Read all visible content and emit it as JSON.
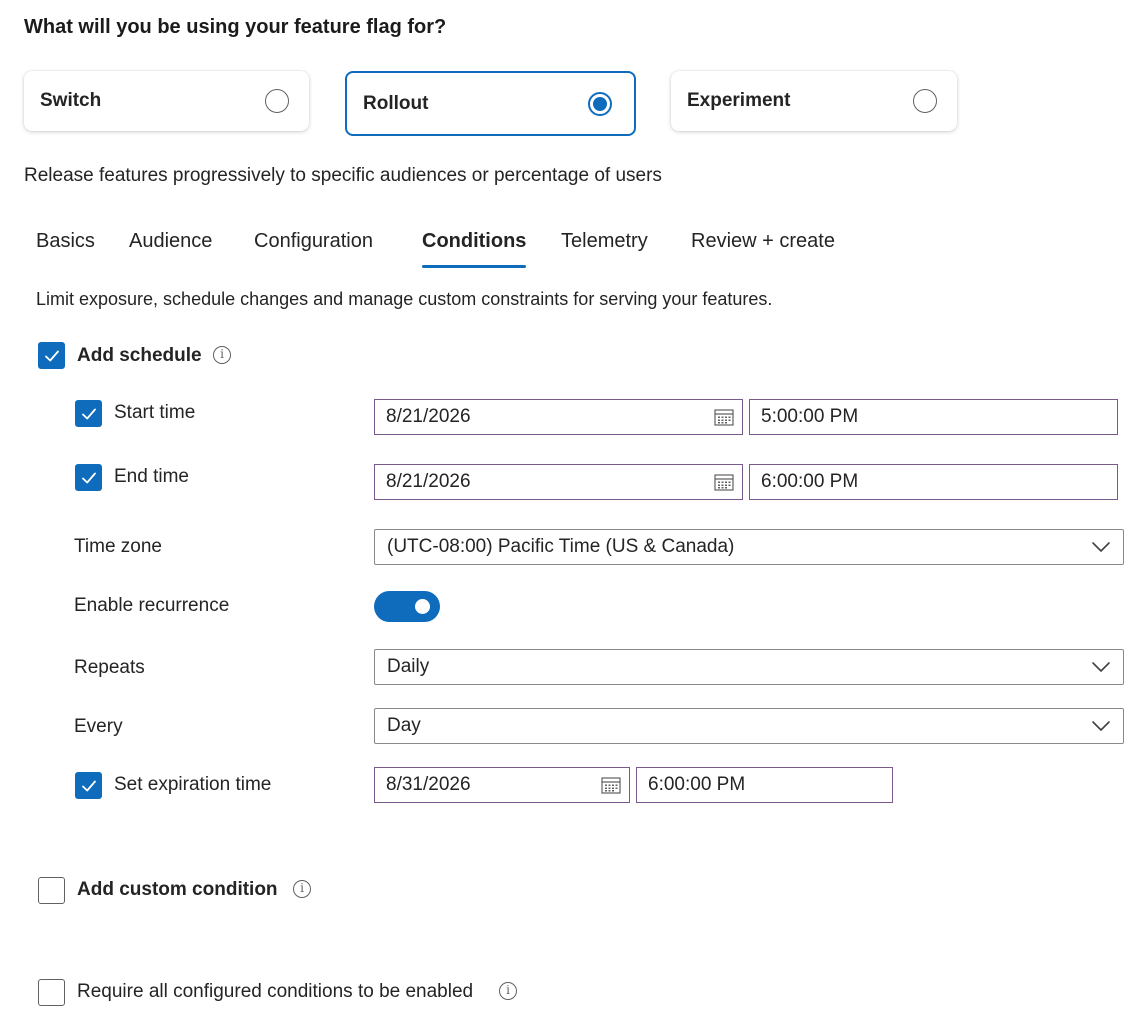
{
  "heading": "What will you be using your feature flag for?",
  "flag_types": [
    {
      "label": "Switch",
      "selected": false
    },
    {
      "label": "Rollout",
      "selected": true
    },
    {
      "label": "Experiment",
      "selected": false
    }
  ],
  "description": "Release features progressively to specific audiences or percentage of users",
  "tabs": [
    "Basics",
    "Audience",
    "Configuration",
    "Conditions",
    "Telemetry",
    "Review + create"
  ],
  "active_tab": "Conditions",
  "conditions_description": "Limit exposure, schedule changes and manage custom constraints for serving your features.",
  "schedule": {
    "label": "Add schedule",
    "checked": true,
    "start_time": {
      "label": "Start time",
      "date": "8/21/2026",
      "time": "5:00:00 PM"
    },
    "end_time": {
      "label": "End time",
      "date": "8/21/2026",
      "time": "6:00:00 PM"
    },
    "time_zone": {
      "label": "Time zone",
      "value": "(UTC-08:00) Pacific Time (US & Canada)"
    },
    "recurrence": {
      "label": "Enable recurrence",
      "enabled": true
    },
    "repeats": {
      "label": "Repeats",
      "value": "Daily"
    },
    "every": {
      "label": "Every",
      "value": "Day"
    },
    "expiration": {
      "label": "Set expiration time",
      "date": "8/31/2026",
      "time": "6:00:00 PM"
    }
  },
  "custom_condition": {
    "label": "Add custom condition",
    "checked": false
  },
  "require_all": {
    "label": "Require all configured conditions to be enabled",
    "checked": false
  },
  "colors": {
    "accent": "#0f6cbd",
    "field_border": "#7a5a8c"
  }
}
